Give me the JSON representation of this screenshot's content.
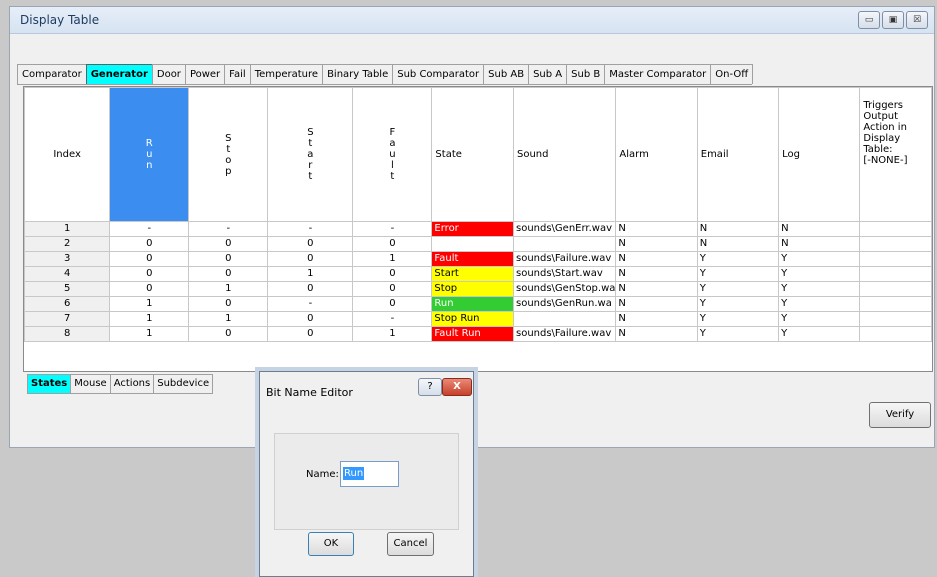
{
  "window": {
    "title": "Display Table"
  },
  "window_buttons": [
    "▭",
    "▣",
    "☒"
  ],
  "tabs": [
    {
      "label": "Comparator",
      "active": false
    },
    {
      "label": "Generator",
      "active": true
    },
    {
      "label": "Door",
      "active": false
    },
    {
      "label": "Power",
      "active": false
    },
    {
      "label": "Fail",
      "active": false
    },
    {
      "label": "Temperature",
      "active": false
    },
    {
      "label": "Binary Table",
      "active": false
    },
    {
      "label": "Sub Comparator",
      "active": false
    },
    {
      "label": "Sub AB",
      "active": false
    },
    {
      "label": "Sub A",
      "active": false
    },
    {
      "label": "Sub B",
      "active": false
    },
    {
      "label": "Master Comparator",
      "active": false
    },
    {
      "label": "On-Off",
      "active": false
    }
  ],
  "table": {
    "headers": {
      "index": "Index",
      "bits": [
        {
          "letters": [
            "R",
            "u",
            "n"
          ],
          "selected": true
        },
        {
          "letters": [
            "S",
            "t",
            "o",
            "p"
          ],
          "selected": false
        },
        {
          "letters": [
            "S",
            "t",
            "a",
            "r",
            "t"
          ],
          "selected": false
        },
        {
          "letters": [
            "F",
            "a",
            "u",
            "l",
            "t"
          ],
          "selected": false
        }
      ],
      "state": "State",
      "sound": "Sound",
      "alarm": "Alarm",
      "email": "Email",
      "log": "Log",
      "triggers": [
        "Triggers",
        "Output",
        "Action in",
        "Display",
        "Table:",
        "[-NONE-]"
      ]
    },
    "rows": [
      {
        "index": "1",
        "run": "-",
        "stop": "-",
        "start": "-",
        "fault": "-",
        "state": "Error",
        "state_color": "#ff0000",
        "state_text_color": "#ffffff",
        "sound": "sounds\\GenErr.wav",
        "alarm": "N",
        "email": "N",
        "log": "N"
      },
      {
        "index": "2",
        "run": "0",
        "stop": "0",
        "start": "0",
        "fault": "0",
        "state": "",
        "state_color": "#ffffff",
        "state_text_color": "#000000",
        "sound": "",
        "alarm": "N",
        "email": "N",
        "log": "N"
      },
      {
        "index": "3",
        "run": "0",
        "stop": "0",
        "start": "0",
        "fault": "1",
        "state": "Fault",
        "state_color": "#ff0000",
        "state_text_color": "#ffffff",
        "sound": "sounds\\Failure.wav",
        "alarm": "N",
        "email": "Y",
        "log": "Y"
      },
      {
        "index": "4",
        "run": "0",
        "stop": "0",
        "start": "1",
        "fault": "0",
        "state": "Start",
        "state_color": "#ffff00",
        "state_text_color": "#000000",
        "sound": "sounds\\Start.wav",
        "alarm": "N",
        "email": "Y",
        "log": "Y"
      },
      {
        "index": "5",
        "run": "0",
        "stop": "1",
        "start": "0",
        "fault": "0",
        "state": "Stop",
        "state_color": "#ffff00",
        "state_text_color": "#000000",
        "sound": "sounds\\GenStop.wa",
        "alarm": "N",
        "email": "Y",
        "log": "Y"
      },
      {
        "index": "6",
        "run": "1",
        "stop": "0",
        "start": "-",
        "fault": "0",
        "state": "Run",
        "state_color": "#33cc33",
        "state_text_color": "#ffffff",
        "sound": "sounds\\GenRun.wa",
        "alarm": "N",
        "email": "Y",
        "log": "Y"
      },
      {
        "index": "7",
        "run": "1",
        "stop": "1",
        "start": "0",
        "fault": "-",
        "state": "Stop Run",
        "state_color": "#ffff00",
        "state_text_color": "#000000",
        "sound": "",
        "alarm": "N",
        "email": "Y",
        "log": "Y"
      },
      {
        "index": "8",
        "run": "1",
        "stop": "0",
        "start": "0",
        "fault": "1",
        "state": "Fault Run",
        "state_color": "#ff0000",
        "state_text_color": "#ffffff",
        "sound": "sounds\\Failure.wav",
        "alarm": "N",
        "email": "Y",
        "log": "Y"
      }
    ]
  },
  "lower_tabs": [
    {
      "label": "States",
      "active": true
    },
    {
      "label": "Mouse",
      "active": false
    },
    {
      "label": "Actions",
      "active": false
    },
    {
      "label": "Subdevice",
      "active": false
    }
  ],
  "verify_label": "Verify",
  "dialog": {
    "title": "Bit Name Editor",
    "help_label": "?",
    "close_label": "X",
    "name_label": "Name:",
    "name_value": "Run",
    "ok_label": "OK",
    "cancel_label": "Cancel"
  }
}
